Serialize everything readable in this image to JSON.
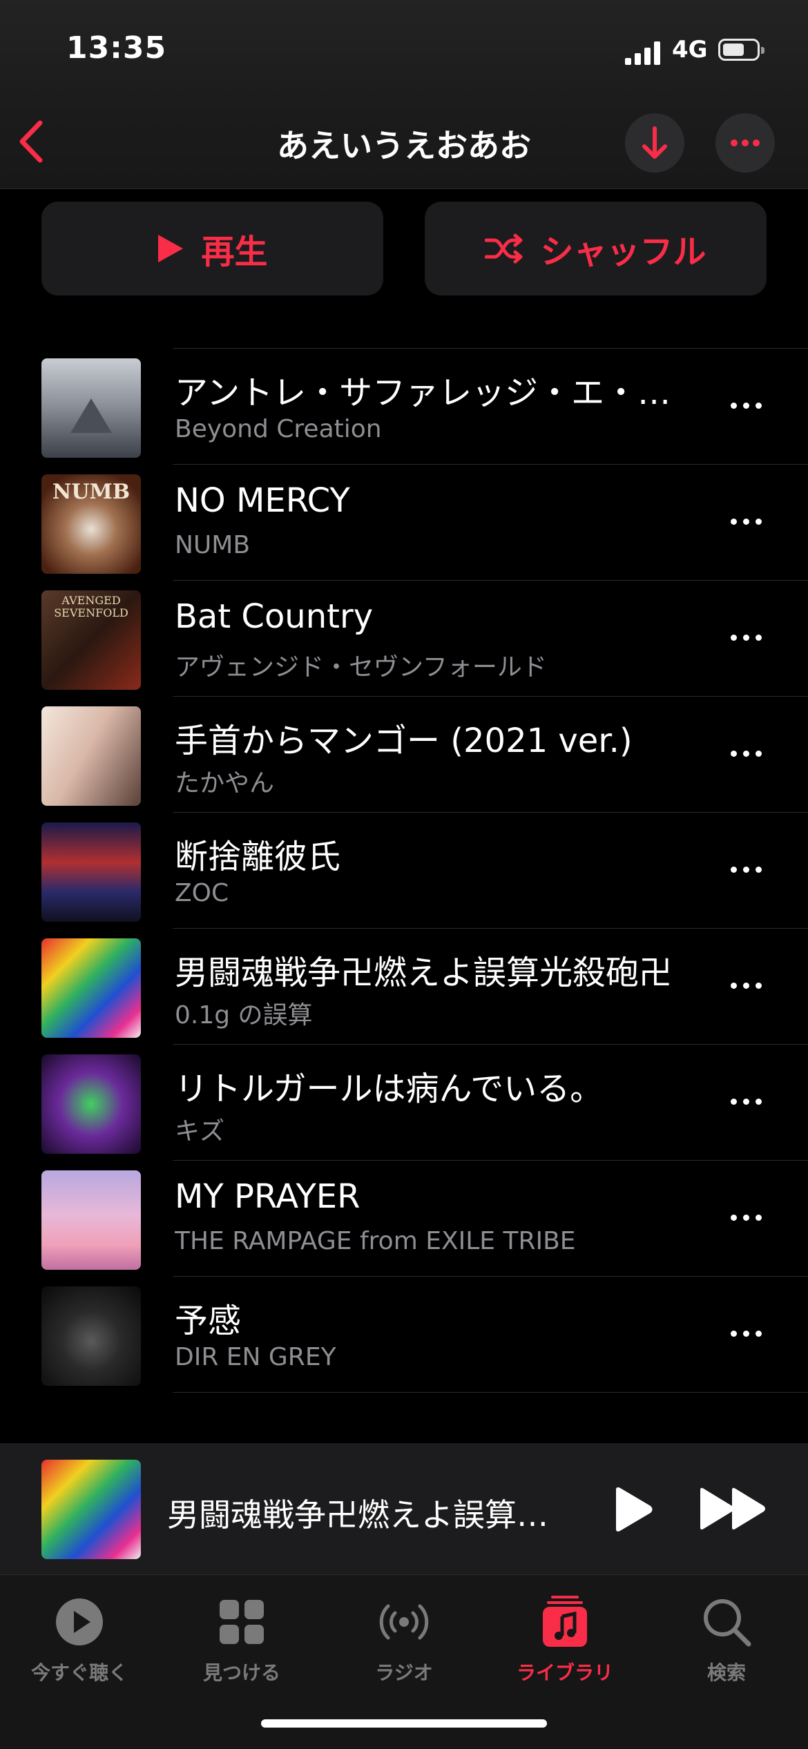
{
  "status_bar": {
    "time": "13:35",
    "network": "4G"
  },
  "header": {
    "title": "あえいうえおあお",
    "back_icon": "chevron-left-icon",
    "download_icon": "arrow-down-icon",
    "more_icon": "ellipsis-icon"
  },
  "actions": {
    "play_label": "再生",
    "shuffle_label": "シャッフル"
  },
  "tracks": [
    {
      "title": "アントレ・サファレッジ・エ・…",
      "artist": "Beyond Creation"
    },
    {
      "title": "NO MERCY",
      "artist": "NUMB"
    },
    {
      "title": "Bat Country",
      "artist": "アヴェンジド・セヴンフォールド"
    },
    {
      "title": "手首からマンゴー (2021 ver.)",
      "artist": "たかやん"
    },
    {
      "title": "断捨離彼氏",
      "artist": "ZOC"
    },
    {
      "title": "男闘魂戦争卍燃えよ誤算光殺砲卍",
      "artist": "0.1g の誤算"
    },
    {
      "title": "リトルガールは病んでいる。",
      "artist": "キズ"
    },
    {
      "title": "MY PRAYER",
      "artist": "THE RAMPAGE from EXILE TRIBE"
    },
    {
      "title": "予感",
      "artist": "DIR EN GREY"
    }
  ],
  "mini_player": {
    "title": "男闘魂戦争卍燃えよ誤算…"
  },
  "tabs": [
    {
      "label": "今すぐ聴く",
      "icon": "play-circle-icon"
    },
    {
      "label": "見つける",
      "icon": "grid-icon"
    },
    {
      "label": "ラジオ",
      "icon": "radio-icon"
    },
    {
      "label": "ライブラリ",
      "icon": "music-note-icon",
      "active": true
    },
    {
      "label": "検索",
      "icon": "search-icon"
    }
  ],
  "colors": {
    "accent": "#fa2d48",
    "background": "#000000",
    "secondary_text": "#8e8e93"
  }
}
